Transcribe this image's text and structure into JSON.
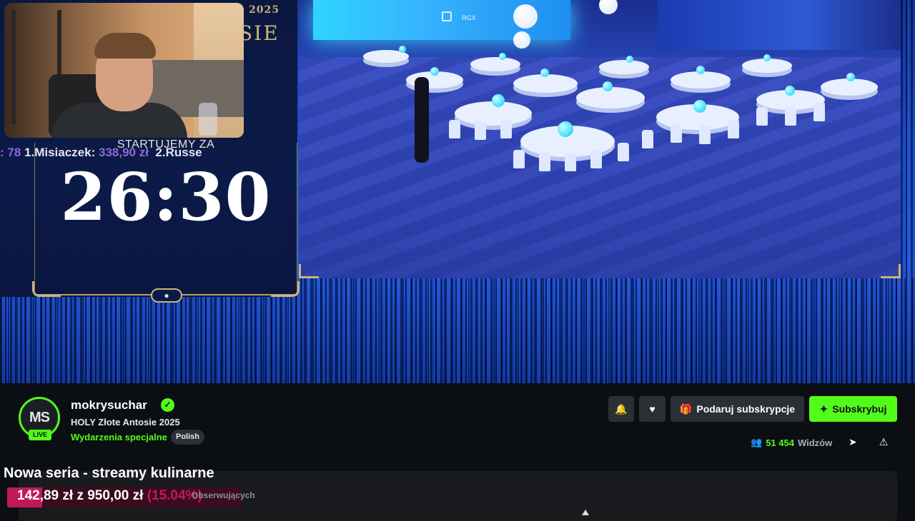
{
  "video": {
    "poster_year": "2025",
    "poster_word": "SIE",
    "startujemy_label": "STARTUJEMY ZA",
    "ticker_prefix": ": 78",
    "ticker_first": "1.Misiaczek:",
    "ticker_first_amount": "338,90 zł",
    "ticker_second": "2.Russe",
    "timer": "26:30",
    "stage_logo": "RGX"
  },
  "channel": {
    "avatar_initials": "MS",
    "live_label": "LIVE",
    "name": "mokrysuchar",
    "stream_title": "HOLY Złote Antosie 2025",
    "category": "Wydarzenia specjalne",
    "language": "Polish",
    "gift_label": "Podaruj subskrypcje",
    "subscribe_label": "Subskrybuj",
    "viewer_count": "51 454",
    "viewer_label": "Widzów",
    "accent_color": "#53fc18"
  },
  "about": {
    "section_title": "Nowa seria - streamy kulinarne",
    "goal_text": "142,89 zł z 950,00 zł",
    "goal_percent_text": "(15.04%)",
    "goal_progress": 0.1504,
    "followers_text": "Obserwujących"
  }
}
